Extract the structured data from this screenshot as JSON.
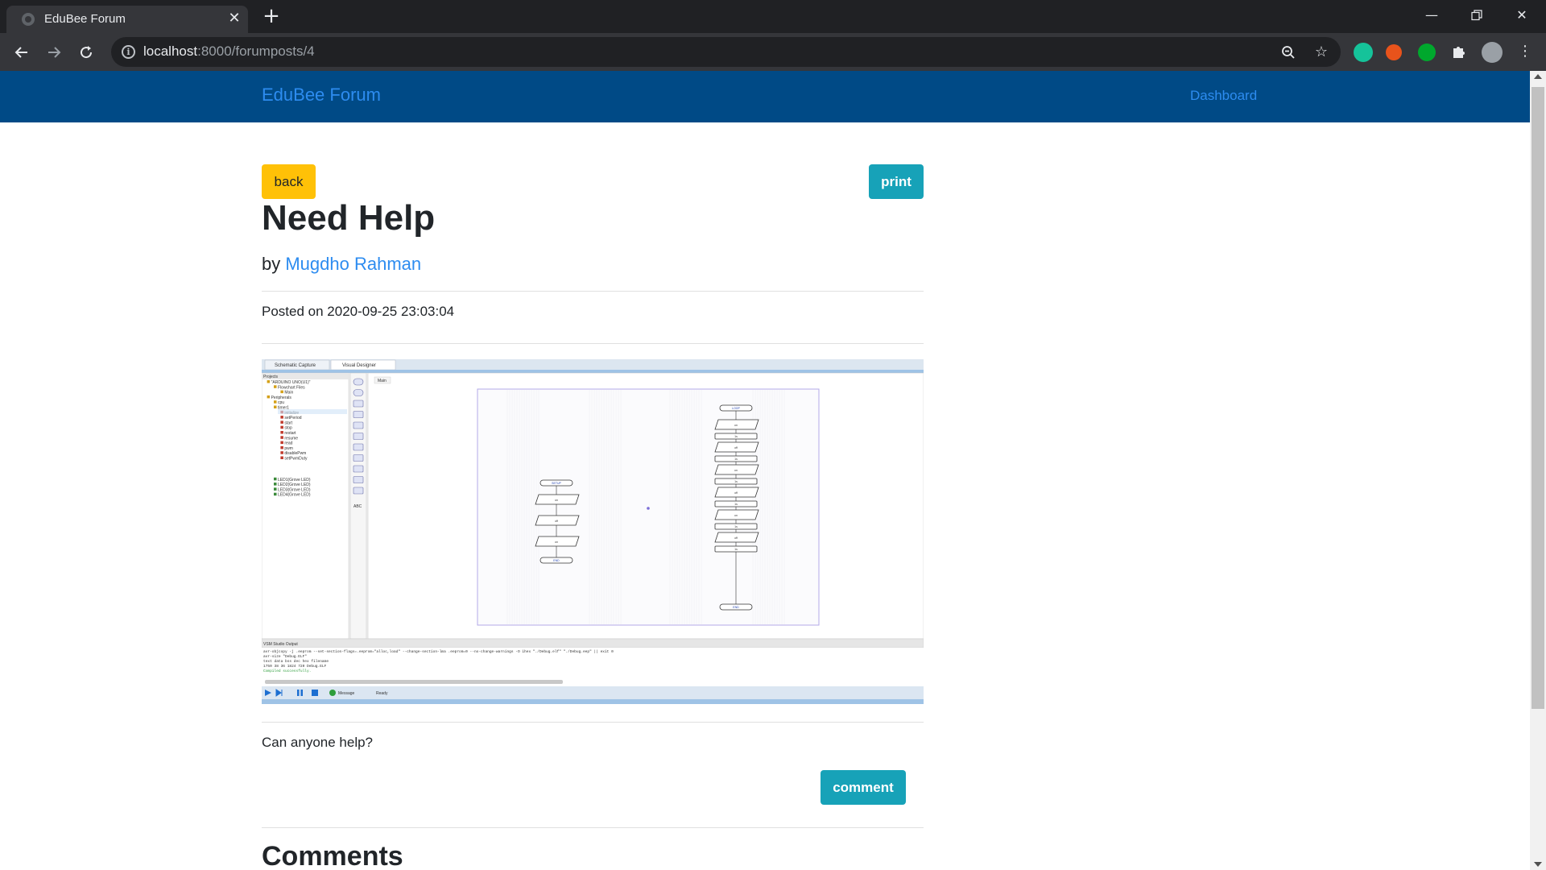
{
  "browser": {
    "tab_title": "EduBee Forum",
    "url_host": "localhost",
    "url_path": ":8000/forumposts/4"
  },
  "navbar": {
    "brand": "EduBee Forum",
    "dashboard_link": "Dashboard"
  },
  "post": {
    "back_label": "back",
    "print_label": "print",
    "title": "Need Help",
    "by_prefix": "by ",
    "author": "Mugdho Rahman",
    "posted": "Posted on 2020-09-25 23:03:04",
    "body": "Can anyone help?",
    "comment_label": "comment",
    "comments_heading": "Comments"
  },
  "attachment": {
    "tabs": [
      "Schematic Capture",
      "Visual Designer"
    ],
    "canvas_tab": "Main",
    "panel_title": "Projects",
    "tree": [
      "\"ARDUINO UNO(U1)\"",
      "Flowchart Files",
      "Main",
      "Peripherals",
      "cpu",
      "timer1",
      "initialize",
      "setPeriod",
      "start",
      "stop",
      "restart",
      "resume",
      "read",
      "pwm",
      "disablePwm",
      "setPwmDuty",
      "LED1(Grove LED)",
      "LED2(Grove LED)",
      "LED3(Grove LED)",
      "LED4(Grove LED)"
    ],
    "output_title": "VSM Studio Output",
    "output_lines": [
      "avr-objcopy -j .eeprom --set-section-flags=.eeprom=\"alloc,load\" --change-section-lma .eeprom=0 --no-change-warnings -O ihex \"./Debug.elf\" \"./Debug.eep\" || exit 0",
      "avr-size \"Debug.ELF\"",
      "text    data    bss    dec    hex    filename",
      "1750    38    36    1824    720    Debug.ELF",
      "Compiled successfully."
    ],
    "status": [
      "Message",
      "Ready"
    ],
    "setup_label": "SETUP",
    "loop_label": "LOOP",
    "end_label": "END",
    "shape_labels": [
      "on",
      "off",
      "on"
    ],
    "loop_shapes": [
      "on",
      "1s",
      "off",
      "1s",
      "on",
      "1s",
      "off",
      "1s",
      "on",
      "1s",
      "off",
      "1s"
    ]
  }
}
